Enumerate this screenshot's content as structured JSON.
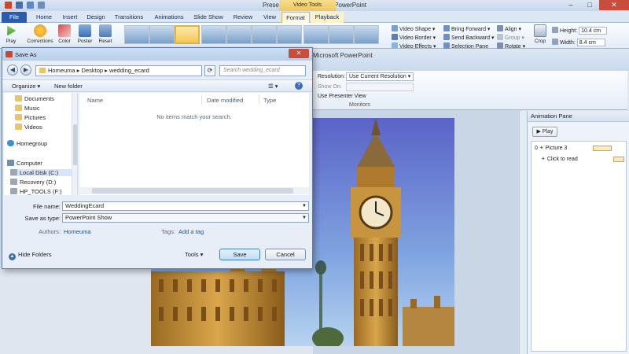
{
  "window": {
    "title": "Presentation1 - Microsoft PowerPoint",
    "context_tab": "Video Tools",
    "title_behind": "Microsoft PowerPoint"
  },
  "tabs": [
    "File",
    "Home",
    "Insert",
    "Design",
    "Transitions",
    "Animations",
    "Slide Show",
    "Review",
    "View",
    "Format",
    "Playback"
  ],
  "ribbon": {
    "play": "Play",
    "corrections": "Corrections",
    "color": "Color",
    "poster": "Poster",
    "reset": "Reset",
    "video_shape": "Video Shape",
    "video_border": "Video Border",
    "video_effects": "Video Effects",
    "bring_forward": "Bring Forward",
    "send_backward": "Send Backward",
    "selection_pane": "Selection Pane",
    "align": "Align",
    "group": "Group",
    "rotate": "Rotate",
    "crop": "Crop",
    "height_label": "Height:",
    "height_value": "10.4 cm",
    "width_label": "Width:",
    "width_value": "8.4 cm"
  },
  "slideshow_ribbon": {
    "resolution_label": "Resolution:",
    "resolution_value": "Use Current Resolution",
    "show_on_label": "Show On:",
    "presenter_view": "Use Presenter View",
    "group_label": "Monitors"
  },
  "dialog": {
    "title": "Save As",
    "breadcrumb": "Homeuma ▸ Desktop ▸ wedding_ecard",
    "search_placeholder": "Search wedding_ecard",
    "organize": "Organize",
    "new_folder": "New folder",
    "tree": [
      {
        "label": "Documents",
        "icon": "documents-folder-icon",
        "color": "#e8c56a"
      },
      {
        "label": "Music",
        "icon": "music-folder-icon",
        "color": "#e8c56a"
      },
      {
        "label": "Pictures",
        "icon": "pictures-folder-icon",
        "color": "#e8c56a"
      },
      {
        "label": "Videos",
        "icon": "videos-folder-icon",
        "color": "#e8c56a"
      },
      {
        "label": "Homegroup",
        "icon": "homegroup-icon",
        "color": "#3b8fd6"
      },
      {
        "label": "Computer",
        "icon": "computer-icon",
        "color": "#6d8fb5"
      },
      {
        "label": "Local Disk (C:)",
        "icon": "disk-icon",
        "color": "#9aa7b5"
      },
      {
        "label": "Recovery (D:)",
        "icon": "disk-icon",
        "color": "#9aa7b5"
      },
      {
        "label": "HP_TOOLS (F:)",
        "icon": "disk-icon",
        "color": "#9aa7b5"
      }
    ],
    "columns": [
      "Name",
      "Date modified",
      "Type"
    ],
    "empty_message": "No items match your search.",
    "file_name_label": "File name:",
    "file_name_value": "WeddingEcard",
    "save_type_label": "Save as type:",
    "save_type_value": "PowerPoint Show",
    "authors_label": "Authors:",
    "authors_value": "Homeuma",
    "tags_label": "Tags:",
    "tags_value": "Add a tag",
    "hide_folders": "Hide Folders",
    "tools": "Tools",
    "save": "Save",
    "cancel": "Cancel"
  },
  "animation_pane": {
    "title": "Animation Pane",
    "play": "Play",
    "items": [
      {
        "index": "0",
        "label": "Picture 3"
      },
      {
        "index": "",
        "label": "Click to read"
      }
    ]
  },
  "colors": {
    "file_tab": "#2a5cab",
    "context_tab": "#efc75e",
    "close_button": "#c94d3d"
  }
}
